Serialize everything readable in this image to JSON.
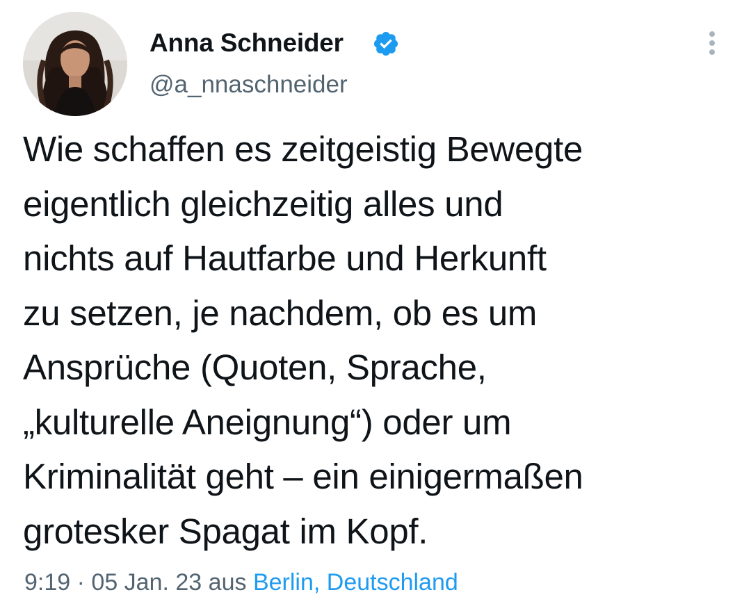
{
  "tweet": {
    "author": {
      "name": "Anna Schneider",
      "handle": "@a_nnaschneider",
      "verified": true,
      "avatar_icon": "profile-photo"
    },
    "text": "Wie schaffen es zeitgeistig Bewegte\neigentlich gleichzeitig alles und\nnichts auf Hautfarbe und Herkunft\nzu setzen, je nachdem, ob es um\nAnsprüche (Quoten, Sprache,\n„kulturelle Aneignung“) oder um\nKriminalität geht – ein einigermaßen\ngrotesker Spagat im Kopf.",
    "time": "9:19",
    "separator": "·",
    "date": "05 Jan. 23",
    "source_prefix": "aus",
    "location": "Berlin, Deutschland"
  },
  "icons": {
    "verified": "verified-badge-icon",
    "more": "more-vertical-icon"
  },
  "colors": {
    "text_primary": "#0f1419",
    "text_secondary": "#536471",
    "accent": "#1d9bf0",
    "background": "#ffffff"
  }
}
